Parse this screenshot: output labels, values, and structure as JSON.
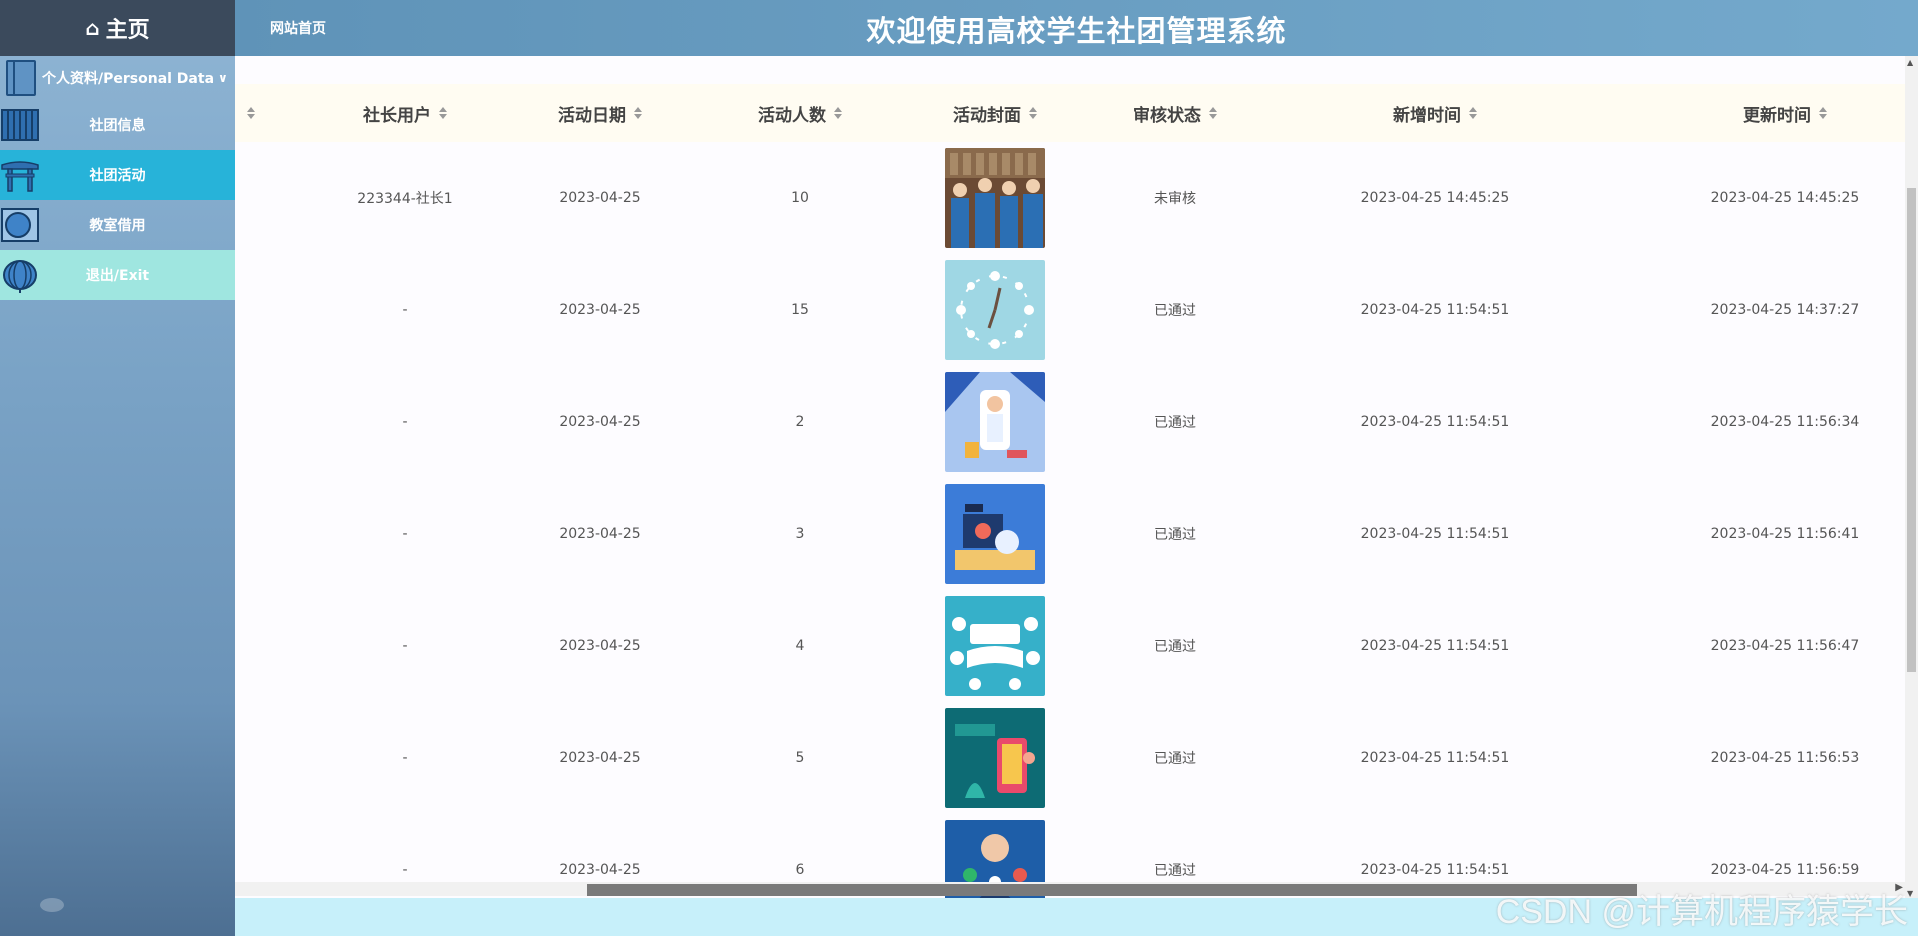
{
  "sidebar": {
    "home_label": "主页",
    "personal_label": "个人资料/Personal Data",
    "items": [
      {
        "label": "社团信息",
        "icon": "radiator-icon"
      },
      {
        "label": "社团活动",
        "icon": "gate-icon"
      },
      {
        "label": "教室借用",
        "icon": "circle-frame-icon"
      },
      {
        "label": "退出/Exit",
        "icon": "lantern-icon"
      }
    ]
  },
  "header": {
    "home_link": "网站首页",
    "title": "欢迎使用高校学生社团管理系统"
  },
  "table": {
    "columns": [
      "社长用户",
      "活动日期",
      "活动人数",
      "活动封面",
      "审核状态",
      "新增时间",
      "更新时间"
    ],
    "rows": [
      {
        "user": "223344-社长1",
        "date": "2023-04-25",
        "count": "10",
        "status": "未审核",
        "created": "2023-04-25 14:45:25",
        "updated": "2023-04-25 14:45:25",
        "cover": "students-photo"
      },
      {
        "user": "-",
        "date": "2023-04-25",
        "count": "15",
        "status": "已通过",
        "created": "2023-04-25 11:54:51",
        "updated": "2023-04-25 14:37:27",
        "cover": "clock-illustration"
      },
      {
        "user": "-",
        "date": "2023-04-25",
        "count": "2",
        "status": "已通过",
        "created": "2023-04-25 11:54:51",
        "updated": "2023-04-25 11:56:34",
        "cover": "doctor-illustration"
      },
      {
        "user": "-",
        "date": "2023-04-25",
        "count": "3",
        "status": "已通过",
        "created": "2023-04-25 11:54:51",
        "updated": "2023-04-25 11:56:41",
        "cover": "study-illustration"
      },
      {
        "user": "-",
        "date": "2023-04-25",
        "count": "4",
        "status": "已通过",
        "created": "2023-04-25 11:54:51",
        "updated": "2023-04-25 11:56:47",
        "cover": "online-education-illustration"
      },
      {
        "user": "-",
        "date": "2023-04-25",
        "count": "5",
        "status": "已通过",
        "created": "2023-04-25 11:54:51",
        "updated": "2023-04-25 11:56:53",
        "cover": "mobile-learning-illustration"
      },
      {
        "user": "-",
        "date": "2023-04-25",
        "count": "6",
        "status": "已通过",
        "created": "2023-04-25 11:54:51",
        "updated": "2023-04-25 11:56:59",
        "cover": "graduate-illustration"
      }
    ]
  },
  "watermark": "CSDN @计算机程序猿学长",
  "colors": {
    "active": "#27b3d9",
    "exit": "#9fe6e0",
    "header": "#6a9fc2"
  }
}
